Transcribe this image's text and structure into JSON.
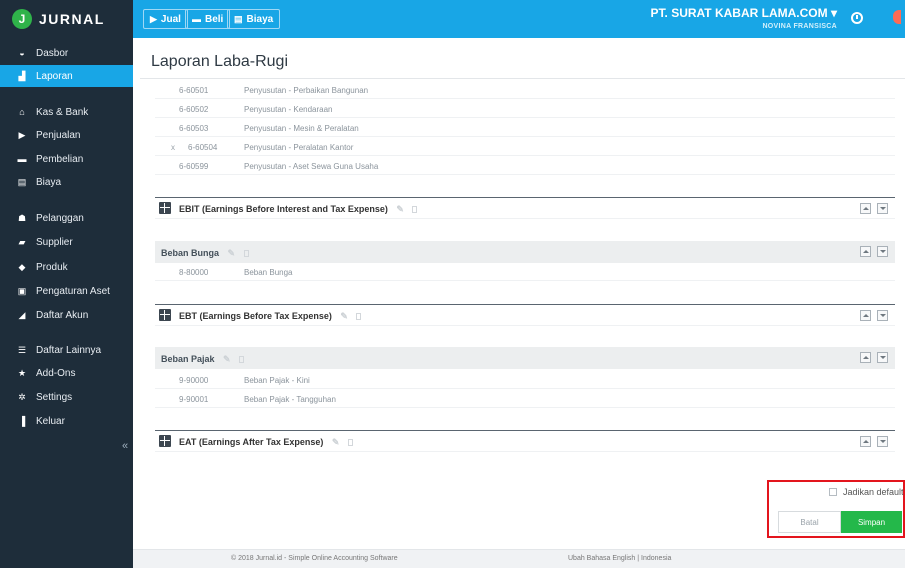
{
  "brand": {
    "logo_letter": "J",
    "name": "JURNAL"
  },
  "sidebar": {
    "items": [
      {
        "label": "Dasbor",
        "icon": "dashboard-icon",
        "glyph": "◒"
      },
      {
        "label": "Laporan",
        "icon": "report-icon",
        "glyph": "▟"
      },
      {
        "label": "Kas & Bank",
        "icon": "bank-icon",
        "glyph": "⌂"
      },
      {
        "label": "Penjualan",
        "icon": "tag-icon",
        "glyph": "▶"
      },
      {
        "label": "Pembelian",
        "icon": "cart-icon",
        "glyph": "▬"
      },
      {
        "label": "Biaya",
        "icon": "receipt-icon",
        "glyph": "▤"
      },
      {
        "label": "Pelanggan",
        "icon": "customers-icon",
        "glyph": "☗"
      },
      {
        "label": "Supplier",
        "icon": "truck-icon",
        "glyph": "▰"
      },
      {
        "label": "Produk",
        "icon": "product-icon",
        "glyph": "◆"
      },
      {
        "label": "Pengaturan Aset",
        "icon": "asset-icon",
        "glyph": "▣"
      },
      {
        "label": "Daftar Akun",
        "icon": "accounts-icon",
        "glyph": "◢"
      },
      {
        "label": "Daftar Lainnya",
        "icon": "list-icon",
        "glyph": "☰"
      },
      {
        "label": "Add-Ons",
        "icon": "star-icon",
        "glyph": "★"
      },
      {
        "label": "Settings",
        "icon": "gear-icon",
        "glyph": "✲"
      },
      {
        "label": "Keluar",
        "icon": "logout-icon",
        "glyph": "▐"
      }
    ],
    "active": "Laporan",
    "collapse_glyph": "«"
  },
  "topbar": {
    "buttons": [
      {
        "label": "Jual",
        "glyph": "▶"
      },
      {
        "label": "Beli",
        "glyph": "▬"
      },
      {
        "label": "Biaya",
        "glyph": "▤"
      }
    ],
    "company_name": "PT. SURAT KABAR LAMA.COM",
    "company_caret": "▾",
    "user_name": "NOVINA FRANSISCA"
  },
  "page": {
    "title": "Laporan Laba-Rugi"
  },
  "depreciation_accounts": [
    {
      "code": "6-60501",
      "name": "Penyusutan - Perbaikan Bangunan",
      "removable": false
    },
    {
      "code": "6-60502",
      "name": "Penyusutan - Kendaraan",
      "removable": false
    },
    {
      "code": "6-60503",
      "name": "Penyusutan - Mesin & Peralatan",
      "removable": false
    },
    {
      "code": "6-60504",
      "name": "Penyusutan - Peralatan Kantor",
      "removable": true
    },
    {
      "code": "6-60599",
      "name": "Penyusutan - Aset Sewa Guna Usaha",
      "removable": false
    }
  ],
  "remove_glyph": "x",
  "sections": {
    "ebit": "EBIT (Earnings Before Interest and Tax Expense)",
    "ebt": "EBT (Earnings Before Tax Expense)",
    "eat": "EAT (Earnings After Tax Expense)"
  },
  "interest_group": {
    "title": "Beban Bunga",
    "accounts": [
      {
        "code": "8-80000",
        "name": "Beban Bunga"
      }
    ]
  },
  "tax_group": {
    "title": "Beban Pajak",
    "accounts": [
      {
        "code": "9-90000",
        "name": "Beban Pajak - Kini"
      },
      {
        "code": "9-90001",
        "name": "Beban Pajak - Tangguhan"
      }
    ]
  },
  "actions": {
    "default_label": "Jadikan default",
    "cancel_label": "Batal",
    "save_label": "Simpan"
  },
  "footer": {
    "copyright": "© 2018 Jurnal.id - Simple Online Accounting Software",
    "language": "Ubah Bahasa English | Indonesia"
  },
  "colors": {
    "sidebar_bg": "#1e2d3a",
    "topbar_bg": "#18a6e6",
    "save_green": "#24b84a",
    "highlight_red": "#e3151d"
  }
}
